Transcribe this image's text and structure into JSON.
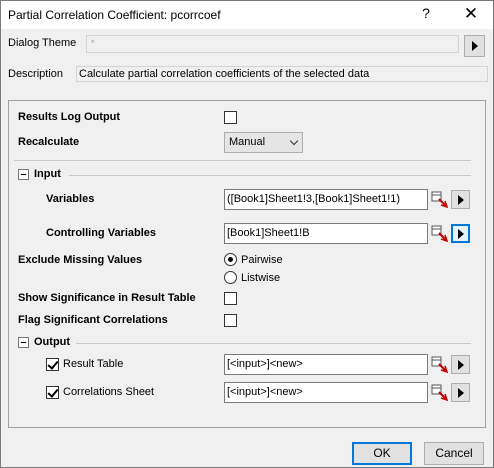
{
  "window": {
    "title": "Partial Correlation Coefficient: pcorrcoef",
    "help_label": "?",
    "close_label": "✕"
  },
  "theme": {
    "label": "Dialog Theme",
    "value": "*"
  },
  "description": {
    "label": "Description",
    "value": "Calculate partial correlation coefficients of the selected data"
  },
  "options": {
    "results_log_label": "Results Log Output",
    "results_log_checked": false,
    "recalculate_label": "Recalculate",
    "recalculate_value": "Manual"
  },
  "input": {
    "section_label": "Input",
    "variables_label": "Variables",
    "variables_value": "([Book1]Sheet1!3,[Book1]Sheet1!1)",
    "controlling_label": "Controlling Variables",
    "controlling_value": "[Book1]Sheet1!B"
  },
  "missing": {
    "label": "Exclude Missing Values",
    "options": [
      "Pairwise",
      "Listwise"
    ],
    "selected": "Pairwise"
  },
  "significance": {
    "show_label": "Show Significance in Result Table",
    "show_checked": false,
    "flag_label": "Flag Significant Correlations",
    "flag_checked": false
  },
  "output": {
    "section_label": "Output",
    "result_table_label": "Result Table",
    "result_table_checked": true,
    "result_table_value": "[<input>]<new>",
    "correlations_label": "Correlations Sheet",
    "correlations_checked": true,
    "correlations_value": "[<input>]<new>"
  },
  "buttons": {
    "ok": "OK",
    "cancel": "Cancel"
  },
  "colors": {
    "accent": "#0078d7",
    "picker_red": "#c00000"
  },
  "icons": [
    "help-icon",
    "close-icon",
    "arrow-right-icon",
    "chevron-down-icon",
    "collapse-icon",
    "select-range-icon"
  ]
}
